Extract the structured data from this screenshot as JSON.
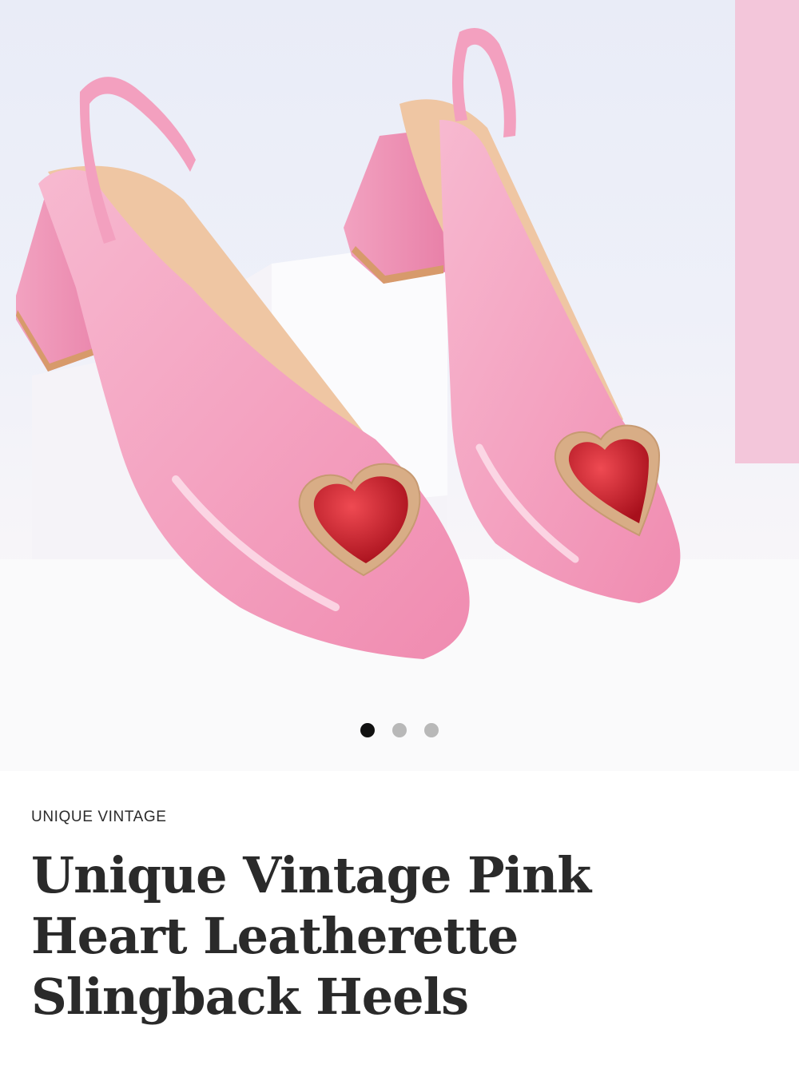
{
  "product": {
    "brand": "UNIQUE VINTAGE",
    "title": "Unique Vintage Pink Heart Leatherette Slingback Heels",
    "image_alt": "Pink patent slingback block heels with red heart buckles"
  },
  "gallery": {
    "slide_count": 3,
    "active_index": 0
  },
  "colors": {
    "shoe_pink": "#f4a7c3",
    "heart_red": "#c81d2a",
    "heart_frame": "#d9b08c",
    "text_dark": "#2a2a2a"
  }
}
